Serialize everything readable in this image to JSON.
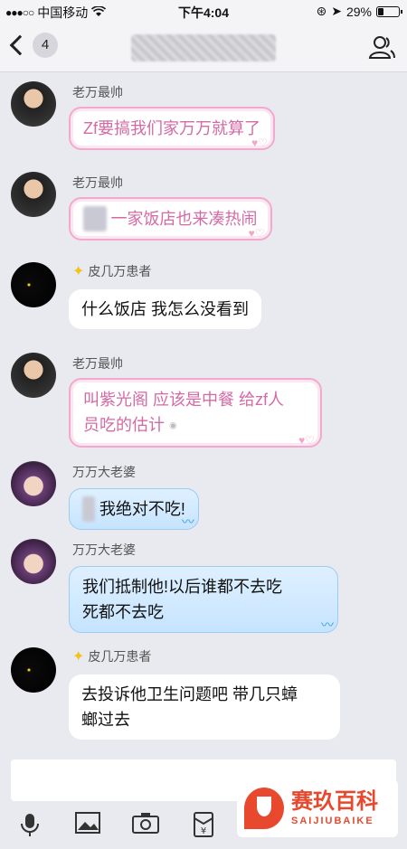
{
  "status_bar": {
    "signal": "●●●○○",
    "carrier": "中国移动",
    "time": "下午4:04",
    "battery_pct_text": "29%",
    "battery_level": 0.29
  },
  "nav": {
    "unread_count": "4",
    "title": ""
  },
  "messages": [
    {
      "sender": "老万最帅",
      "avatar": "man-avatar",
      "style": "pink",
      "text": "Zf要搞我们家万万就算了"
    },
    {
      "sender": "老万最帅",
      "avatar": "man-avatar",
      "style": "pink",
      "text": "一家饭店也来凑热闹"
    },
    {
      "sender": "皮几万患者",
      "avatar": "dark-avatar",
      "style": "white",
      "text": "什么饭店 我怎么没看到"
    },
    {
      "sender": "老万最帅",
      "avatar": "man-avatar",
      "style": "pink",
      "text_line1": "叫紫光阁 应该是中餐 给zf人",
      "text_line2": "员吃的估计"
    },
    {
      "sender": "万万大老婆",
      "avatar": "girl-avatar",
      "style": "blue",
      "text": "我绝对不吃!"
    },
    {
      "sender": "万万大老婆",
      "avatar": "girl-avatar",
      "style": "blue",
      "text_line1": "我们抵制他!以后谁都不去吃",
      "text_line2": "死都不去吃"
    },
    {
      "sender": "皮几万患者",
      "avatar": "dark-avatar",
      "style": "white",
      "text_line1": "去投诉他卫生问题吧 带几只蟑",
      "text_line2": "螂过去"
    }
  ],
  "toolbar": {
    "icons": [
      "microphone-icon",
      "image-icon",
      "camera-icon",
      "red-packet-icon"
    ]
  },
  "logo": {
    "cn": "赛玖百科",
    "en": "SAIJIUBAIKE"
  },
  "colors": {
    "pink_text": "#d46aa4",
    "blue_bubble": "#c6e4ff",
    "background": "#e9e9f0"
  }
}
